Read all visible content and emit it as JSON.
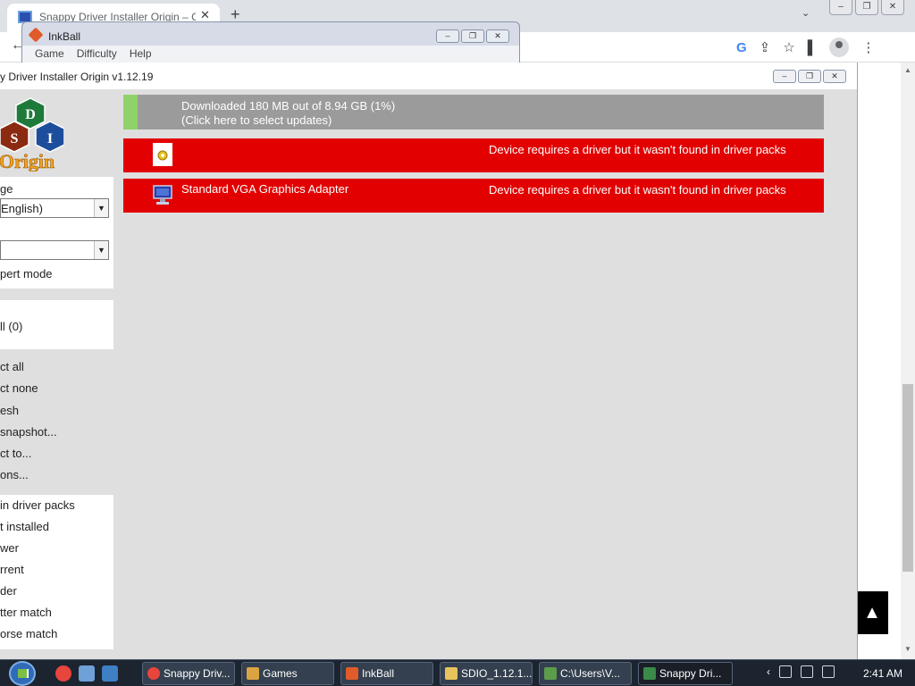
{
  "browser": {
    "tab_title": "Snappy Driver Installer Origin – C",
    "tab_close": "✕",
    "new_tab": "+",
    "tab_search": "⌄",
    "win_buttons": [
      "–",
      "❐",
      "✕"
    ],
    "back": "←",
    "toolbar_icons": [
      "G",
      "⇪",
      "☆",
      "▌"
    ],
    "menu": "⋮",
    "float_button": "▲"
  },
  "inkball": {
    "title": "InkBall",
    "controls": [
      "–",
      "❐",
      "✕"
    ],
    "menu": [
      "Game",
      "Difficulty",
      "Help"
    ]
  },
  "sdi": {
    "title": "y Driver Installer Origin v1.12.19",
    "controls": [
      "–",
      "❐",
      "✕"
    ],
    "logo": {
      "letters": [
        "D",
        "S",
        "I"
      ],
      "text": "Origin"
    },
    "language_label": "ge",
    "language_value": "English)",
    "theme_value": "",
    "expert_mode": "pert mode",
    "install_label": "ll (0)",
    "actions": [
      "ct all",
      "ct none",
      "esh",
      " snapshot...",
      "ct to...",
      "ons..."
    ],
    "filters": [
      "in driver packs",
      "t installed",
      "wer",
      "rrent",
      "der",
      "tter match",
      "orse match"
    ],
    "download": {
      "line1": "Downloaded 180 MB out of 8.94 GB (1%)",
      "line2": "(Click here to select updates)",
      "progress": 0.02
    },
    "devices": [
      {
        "name": "",
        "status": "Device requires a driver but it wasn't found in driver packs",
        "icon": "gear-file-icon"
      },
      {
        "name": "Standard VGA Graphics Adapter",
        "status": "Device requires a driver but it wasn't found in driver packs",
        "icon": "monitor-icon"
      }
    ]
  },
  "taskbar": {
    "buttons": [
      {
        "label": "Snappy Driv...",
        "icon": "chrome-icon",
        "color": "#e8453c"
      },
      {
        "label": "Games",
        "icon": "games-icon",
        "color": "#d9a441"
      },
      {
        "label": "InkBall",
        "icon": "inkball-icon",
        "color": "#e05a2a"
      },
      {
        "label": "SDIO_1.12.1...",
        "icon": "folder-icon",
        "color": "#e6c35c"
      },
      {
        "label": "C:\\Users\\V...",
        "icon": "cmd-icon",
        "color": "#5c9c4a"
      },
      {
        "label": "Snappy Dri...",
        "icon": "sdi-icon",
        "color": "#3a8a4a"
      }
    ],
    "tray_chevron": "‹",
    "clock": "2:41 AM"
  }
}
